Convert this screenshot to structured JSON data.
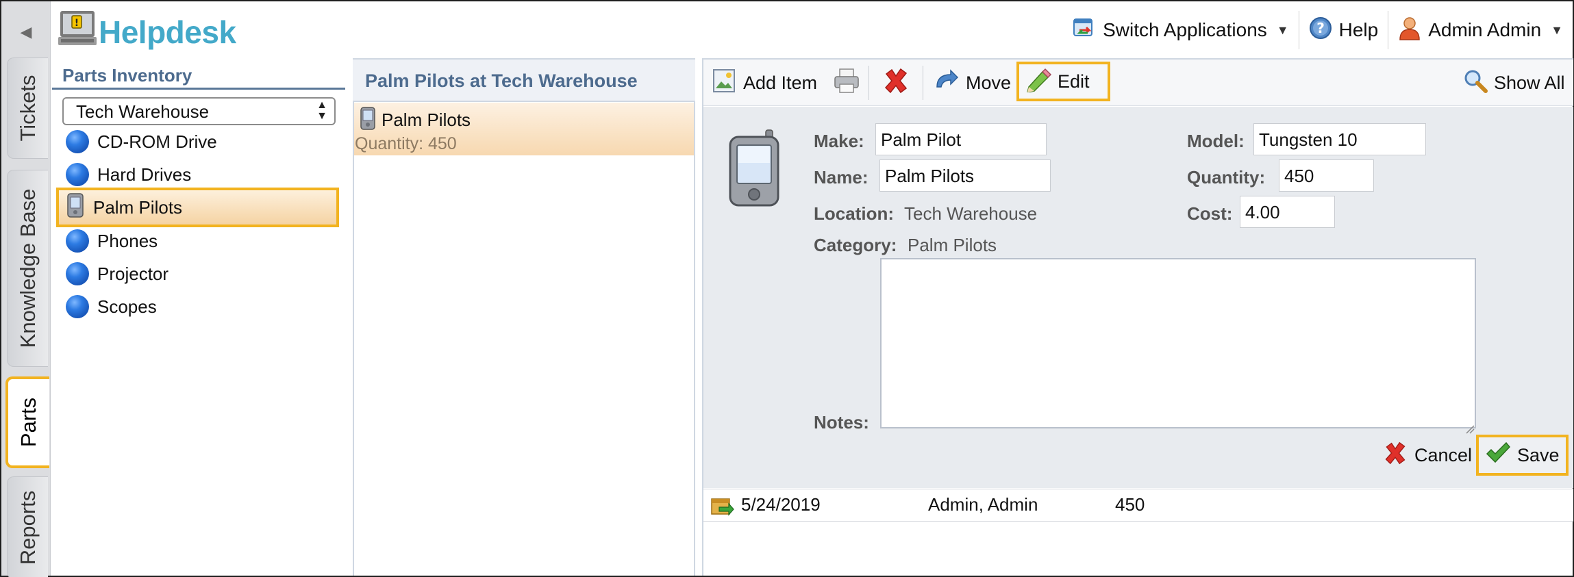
{
  "app": {
    "title": "Helpdesk"
  },
  "header": {
    "switch_label": "Switch Applications",
    "help_label": "Help",
    "user_label": "Admin Admin"
  },
  "tabs": [
    {
      "label": "Tickets"
    },
    {
      "label": "Knowledge Base"
    },
    {
      "label": "Parts",
      "active": true
    },
    {
      "label": "Reports"
    }
  ],
  "inventory": {
    "title": "Parts Inventory",
    "location_selected": "Tech Warehouse",
    "categories": [
      {
        "label": "CD-ROM Drive",
        "icon": "blue-sphere-icon"
      },
      {
        "label": "Hard Drives",
        "icon": "blue-sphere-icon"
      },
      {
        "label": "Palm Pilots",
        "icon": "pda-icon",
        "selected": true
      },
      {
        "label": "Phones",
        "icon": "blue-sphere-icon"
      },
      {
        "label": "Projector",
        "icon": "blue-sphere-icon"
      },
      {
        "label": "Scopes",
        "icon": "blue-sphere-icon"
      }
    ]
  },
  "list": {
    "title": "Palm Pilots at Tech Warehouse",
    "items": [
      {
        "name": "Palm Pilots",
        "quantity": "Quantity: 450"
      }
    ]
  },
  "toolbar": {
    "add_item": "Add Item",
    "move": "Move",
    "edit": "Edit",
    "show_all": "Show All"
  },
  "detail": {
    "make_label": "Make:",
    "make": "Palm Pilot",
    "model_label": "Model:",
    "model": "Tungsten 10",
    "name_label": "Name:",
    "name": "Palm Pilots",
    "quantity_label": "Quantity:",
    "quantity": "450",
    "location_label": "Location:",
    "location": "Tech Warehouse",
    "cost_label": "Cost:",
    "cost": "4.00",
    "category_label": "Category:",
    "category": "Palm Pilots",
    "notes_label": "Notes:",
    "notes": ""
  },
  "actions": {
    "cancel": "Cancel",
    "save": "Save"
  },
  "history": [
    {
      "date": "5/24/2019",
      "user": "Admin, Admin",
      "quantity": "450"
    }
  ],
  "colors": {
    "accent_highlight": "#f2b320",
    "brand": "#43a9c9",
    "panel_title": "#4d6b8e"
  }
}
